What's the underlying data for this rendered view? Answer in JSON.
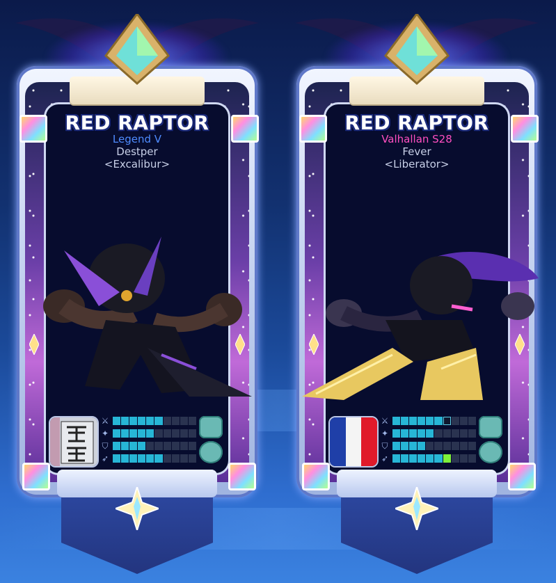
{
  "cards": [
    {
      "legend_name": "RED RAPTOR",
      "rank": "Legend V",
      "rank_color": "#4f8cff",
      "player": "Destper",
      "clan": "<Excalibur>",
      "portrait_icon": "city-sign-icon",
      "stats": [
        {
          "icon": "sword-icon",
          "filled": 6,
          "total": 10
        },
        {
          "icon": "shield-icon",
          "filled": 5,
          "total": 10
        },
        {
          "icon": "defense-icon",
          "filled": 4,
          "total": 10
        },
        {
          "icon": "run-icon",
          "filled": 6,
          "total": 10
        }
      ],
      "weapons": [
        "gauntlets-icon",
        "orb-icon"
      ]
    },
    {
      "legend_name": "RED RAPTOR",
      "rank": "Valhallan S28",
      "rank_color": "#ff4fc0",
      "player": "Fever",
      "clan": "<Liberator>",
      "portrait_icon": "france-flag-icon",
      "stats": [
        {
          "icon": "sword-icon",
          "filled": 6,
          "total": 10,
          "mark_at": 6
        },
        {
          "icon": "shield-icon",
          "filled": 5,
          "total": 10
        },
        {
          "icon": "defense-icon",
          "filled": 4,
          "total": 10
        },
        {
          "icon": "run-icon",
          "filled": 6,
          "total": 10,
          "green_at": 6
        }
      ],
      "weapons": [
        "gauntlets-icon",
        "orb-icon"
      ]
    }
  ]
}
